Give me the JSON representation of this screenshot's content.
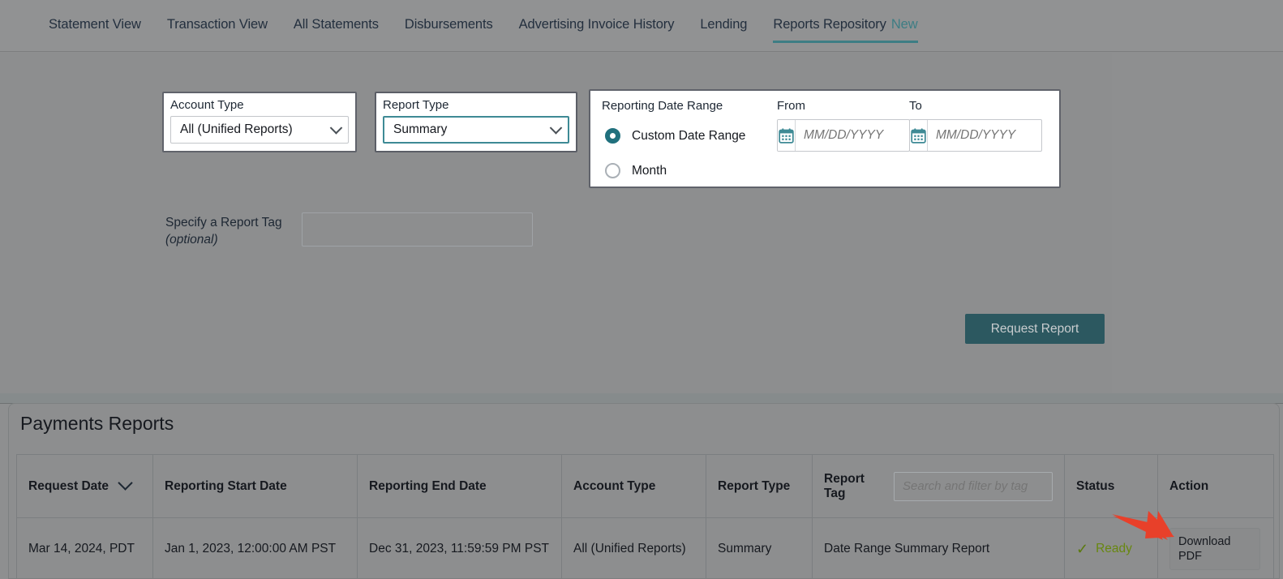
{
  "nav": {
    "items": [
      {
        "label": "Statement View",
        "active": false
      },
      {
        "label": "Transaction View",
        "active": false
      },
      {
        "label": "All Statements",
        "active": false
      },
      {
        "label": "Disbursements",
        "active": false
      },
      {
        "label": "Advertising Invoice History",
        "active": false
      },
      {
        "label": "Lending",
        "active": false
      },
      {
        "label": "Reports Repository",
        "active": true
      }
    ],
    "new_badge": "New"
  },
  "form": {
    "account_type": {
      "label": "Account Type",
      "value": "All (Unified Reports)"
    },
    "report_type": {
      "label": "Report Type",
      "value": "Summary"
    },
    "date_range": {
      "title": "Reporting Date Range",
      "from_label": "From",
      "to_label": "To",
      "options": [
        {
          "label": "Custom Date Range",
          "selected": true
        },
        {
          "label": "Month",
          "selected": false
        }
      ],
      "from_value": "",
      "from_placeholder": "MM/DD/YYYY",
      "to_value": "",
      "to_placeholder": "MM/DD/YYYY"
    },
    "report_tag": {
      "label": "Specify a Report Tag",
      "label_optional": "(optional)",
      "value": "",
      "placeholder": ""
    },
    "request_button": "Request Report"
  },
  "reports": {
    "title": "Payments Reports",
    "columns": [
      "Request Date",
      "Reporting Start Date",
      "Reporting End Date",
      "Account Type",
      "Report Type",
      "Report Tag",
      "Status",
      "Action"
    ],
    "tag_filter_placeholder": "Search and filter by tag",
    "rows": [
      {
        "request_date": "Mar 14, 2024, PDT",
        "reporting_start_date": "Jan 1, 2023, 12:00:00 AM PST",
        "reporting_end_date": "Dec 31, 2023, 11:59:59 PM PST",
        "account_type": "All (Unified Reports)",
        "report_type": "Summary",
        "report_tag": "Date Range Summary Report",
        "status": "Ready",
        "action": "Download PDF"
      }
    ]
  },
  "colors": {
    "accent_teal": "#3d7d84",
    "button_bg": "#2c5860",
    "status_green": "#68870f",
    "annotation_red": "#e8402a"
  }
}
